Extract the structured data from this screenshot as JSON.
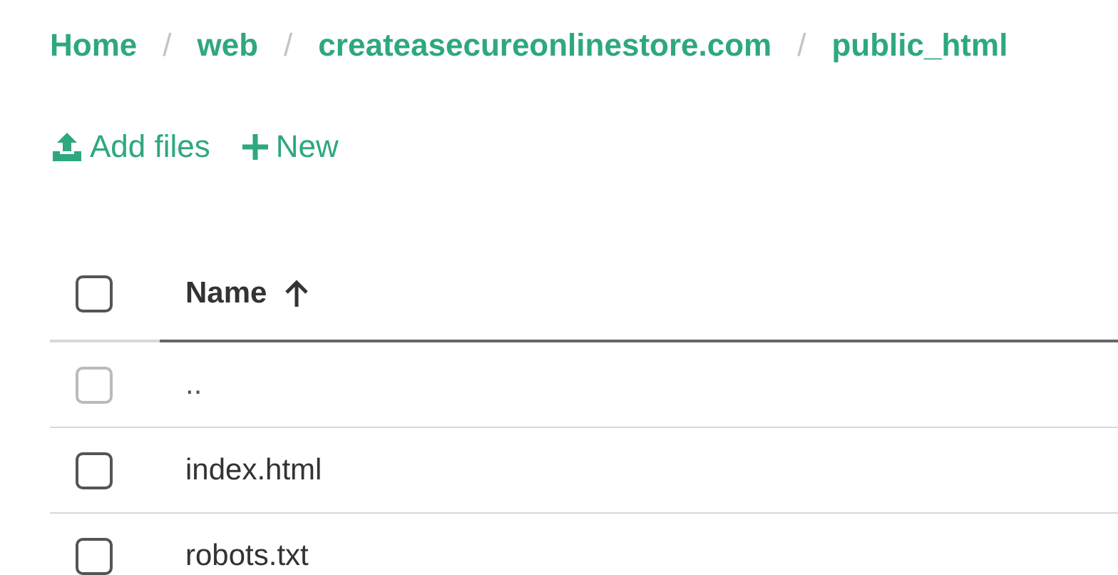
{
  "breadcrumbs": [
    {
      "kind": "link",
      "label": "Home"
    },
    {
      "kind": "separator",
      "label": "/"
    },
    {
      "kind": "link",
      "label": "web"
    },
    {
      "kind": "separator",
      "label": "/"
    },
    {
      "kind": "link",
      "label": "createasecureonlinestore.com"
    },
    {
      "kind": "separator",
      "label": "/"
    },
    {
      "kind": "link",
      "label": "public_html"
    }
  ],
  "toolbar": [
    {
      "kind": "upload",
      "label": "Add files"
    },
    {
      "kind": "plus",
      "label": "New"
    }
  ],
  "table": {
    "header": {
      "label": "Name",
      "checked": false,
      "sorted_ascending": true
    },
    "rows": [
      {
        "name": "..",
        "checked": false,
        "disabled": true
      },
      {
        "name": "index.html",
        "checked": false,
        "disabled": false
      },
      {
        "name": "robots.txt",
        "checked": false,
        "disabled": false
      }
    ]
  }
}
